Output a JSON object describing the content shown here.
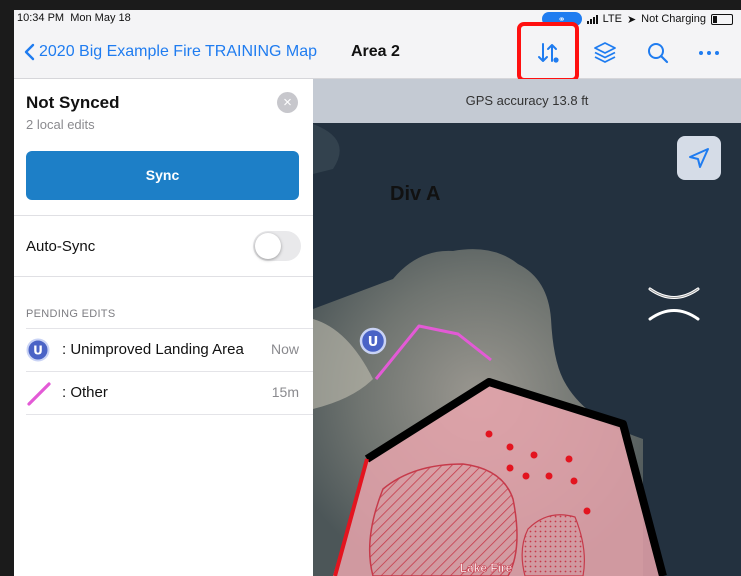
{
  "status_bar": {
    "time": "10:34 PM",
    "date": "Mon May 18",
    "carrier": "LTE",
    "battery_text": "Not Charging"
  },
  "navbar": {
    "back_label": "2020 Big Example Fire TRAINING Map",
    "title": "Area 2",
    "icons": [
      "sync-arrows-icon",
      "layers-icon",
      "search-icon",
      "more-icon"
    ],
    "accent": "#1f7cf0",
    "highlight_color": "#ff1010"
  },
  "panel": {
    "title": "Not Synced",
    "subtitle": "2 local edits",
    "sync_label": "Sync",
    "sync_color": "#1d7fc7",
    "autosync_label": "Auto-Sync",
    "autosync_on": false,
    "pending_header": "PENDING EDITS",
    "edits": [
      {
        "icon": "unimproved-landing-icon",
        "badge": "U",
        "label": ": Unimproved Landing Area",
        "time": "Now"
      },
      {
        "icon": "pink-line-icon",
        "label": ": Other",
        "time": "15m"
      }
    ]
  },
  "map": {
    "gps_text": "GPS accuracy 13.8 ft",
    "division_label": "Div A",
    "fire_label": "Lake Fire",
    "marker_badge": "U"
  }
}
